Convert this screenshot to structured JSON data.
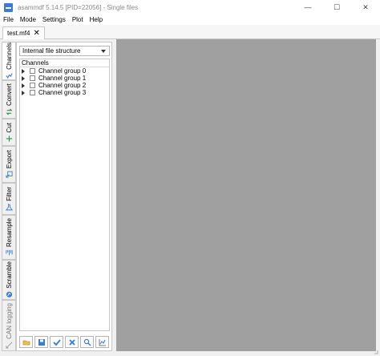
{
  "window": {
    "title": "asammdf 5.14.5 [PID=22056] - Single files",
    "minimize": "—",
    "maximize": "☐",
    "close": "✕"
  },
  "menu": {
    "items": [
      "File",
      "Mode",
      "Settings",
      "Plot",
      "Help"
    ]
  },
  "tabs": {
    "file_tab": "test.mf4",
    "close_glyph": "✕"
  },
  "sidetabs": [
    {
      "label": "Channels",
      "icon": "channels-icon",
      "active": true
    },
    {
      "label": "Convert",
      "icon": "convert-icon",
      "active": false
    },
    {
      "label": "Cut",
      "icon": "cut-icon",
      "active": false
    },
    {
      "label": "Export",
      "icon": "export-icon",
      "active": false
    },
    {
      "label": "Filter",
      "icon": "filter-icon",
      "active": false
    },
    {
      "label": "Resample",
      "icon": "resample-icon",
      "active": false
    },
    {
      "label": "Scramble",
      "icon": "scramble-icon",
      "active": false
    },
    {
      "label": "CAN logging",
      "icon": "can-logging-icon",
      "active": false
    }
  ],
  "channels_panel": {
    "view_mode": "Internal file structure",
    "tree_header": "Channels",
    "groups": [
      "Channel group 0",
      "Channel group 1",
      "Channel group 2",
      "Channel group 3"
    ],
    "toolbar": [
      "open-folder-icon",
      "save-icon",
      "check-all-icon",
      "uncheck-all-icon",
      "search-icon",
      "plot-icon"
    ]
  },
  "colors": {
    "accent": "#3a7bd5",
    "plot_background": "#a0a0a0"
  }
}
